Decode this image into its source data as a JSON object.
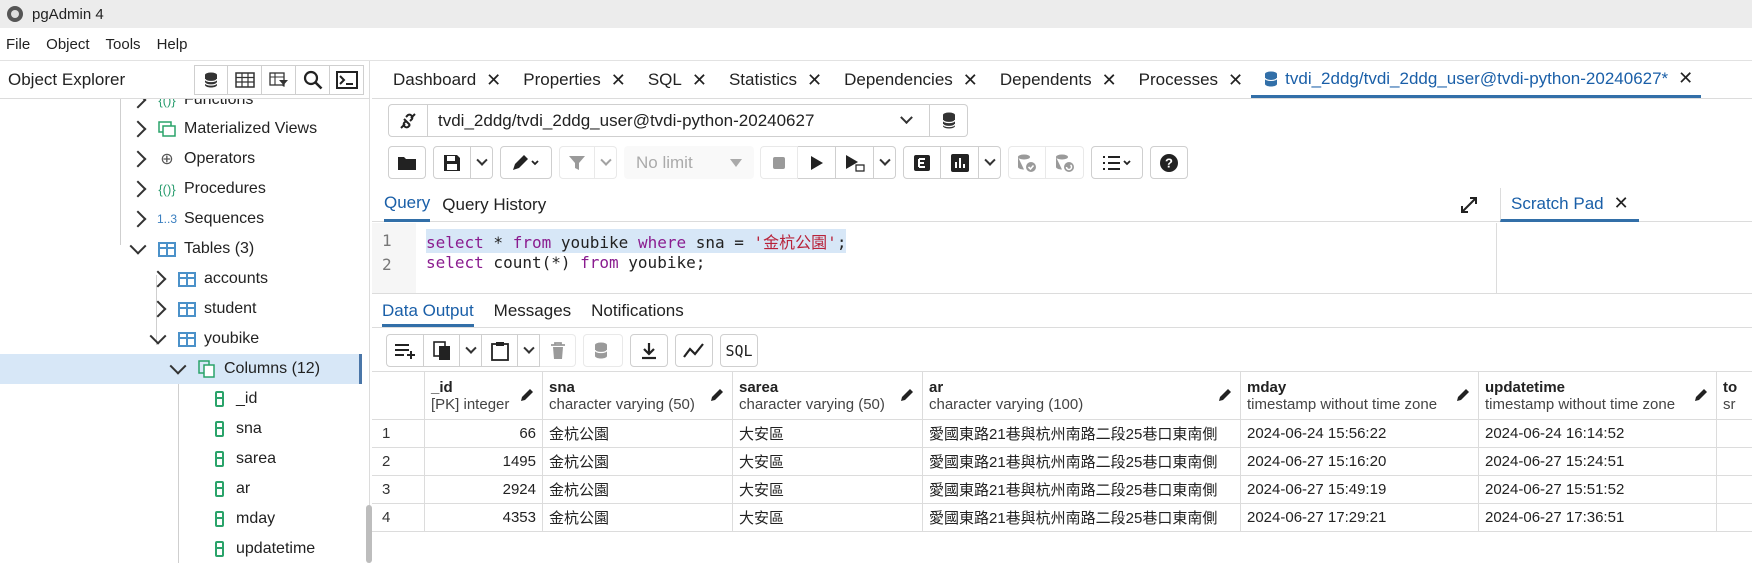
{
  "app": {
    "title": "pgAdmin 4"
  },
  "menu": [
    "File",
    "Object",
    "Tools",
    "Help"
  ],
  "explorer": {
    "title": "Object Explorer",
    "tree": [
      {
        "label": "Functions",
        "state": "collapsed",
        "icon": "functions-icon"
      },
      {
        "label": "Materialized Views",
        "state": "collapsed",
        "icon": "matview-icon"
      },
      {
        "label": "Operators",
        "state": "collapsed",
        "icon": "operators-icon"
      },
      {
        "label": "Procedures",
        "state": "collapsed",
        "icon": "procedures-icon"
      },
      {
        "label": "Sequences",
        "state": "collapsed",
        "icon": "sequences-icon"
      },
      {
        "label": "Tables (3)",
        "state": "expanded",
        "icon": "tables-icon"
      },
      {
        "label": "accounts",
        "state": "collapsed",
        "icon": "table-icon"
      },
      {
        "label": "student",
        "state": "collapsed",
        "icon": "table-icon"
      },
      {
        "label": "youbike",
        "state": "expanded",
        "icon": "table-icon"
      },
      {
        "label": "Columns (12)",
        "state": "expanded",
        "icon": "columns-icon",
        "selected": true
      },
      {
        "label": "_id",
        "icon": "column-icon"
      },
      {
        "label": "sna",
        "icon": "column-icon"
      },
      {
        "label": "sarea",
        "icon": "column-icon"
      },
      {
        "label": "ar",
        "icon": "column-icon"
      },
      {
        "label": "mday",
        "icon": "column-icon"
      },
      {
        "label": "updatetime",
        "icon": "column-icon"
      }
    ]
  },
  "tabs": [
    {
      "label": "Dashboard"
    },
    {
      "label": "Properties"
    },
    {
      "label": "SQL"
    },
    {
      "label": "Statistics"
    },
    {
      "label": "Dependencies"
    },
    {
      "label": "Dependents"
    },
    {
      "label": "Processes"
    },
    {
      "label": "tvdi_2ddg/tvdi_2ddg_user@tvdi-python-20240627*",
      "active": true
    }
  ],
  "connection": {
    "value": "tvdi_2ddg/tvdi_2ddg_user@tvdi-python-20240627"
  },
  "toolbar": {
    "limit": "No limit"
  },
  "query_tabs": {
    "query": "Query",
    "history": "Query History",
    "scratch": "Scratch Pad"
  },
  "editor": {
    "lines": [
      {
        "n": "1",
        "kw1": "select",
        "t1": " * ",
        "kw2": "from",
        "t2": " youbike ",
        "kw3": "where",
        "t3": " sna = ",
        "str": "'金杭公園'",
        "t4": ";"
      },
      {
        "n": "2",
        "kw1": "select",
        "t1": " count(*) ",
        "kw2": "from",
        "t2": " youbike;"
      }
    ]
  },
  "output_tabs": [
    "Data Output",
    "Messages",
    "Notifications"
  ],
  "sql_button": "SQL",
  "columns": [
    {
      "name": "_id",
      "type": "[PK] integer"
    },
    {
      "name": "sna",
      "type": "character varying (50)"
    },
    {
      "name": "sarea",
      "type": "character varying (50)"
    },
    {
      "name": "ar",
      "type": "character varying (100)"
    },
    {
      "name": "mday",
      "type": "timestamp without time zone"
    },
    {
      "name": "updatetime",
      "type": "timestamp without time zone"
    },
    {
      "name": "to",
      "type": "sr"
    }
  ],
  "rows": [
    {
      "n": "1",
      "cells": [
        "66",
        "金杭公園",
        "大安區",
        "愛國東路21巷與杭州南路二段25巷口東南側",
        "2024-06-24 15:56:22",
        "2024-06-24 16:14:52"
      ]
    },
    {
      "n": "2",
      "cells": [
        "1495",
        "金杭公園",
        "大安區",
        "愛國東路21巷與杭州南路二段25巷口東南側",
        "2024-06-27 15:16:20",
        "2024-06-27 15:24:51"
      ]
    },
    {
      "n": "3",
      "cells": [
        "2924",
        "金杭公園",
        "大安區",
        "愛國東路21巷與杭州南路二段25巷口東南側",
        "2024-06-27 15:49:19",
        "2024-06-27 15:51:52"
      ]
    },
    {
      "n": "4",
      "cells": [
        "4353",
        "金杭公園",
        "大安區",
        "愛國東路21巷與杭州南路二段25巷口東南側",
        "2024-06-27 17:29:21",
        "2024-06-27 17:36:51"
      ]
    }
  ]
}
